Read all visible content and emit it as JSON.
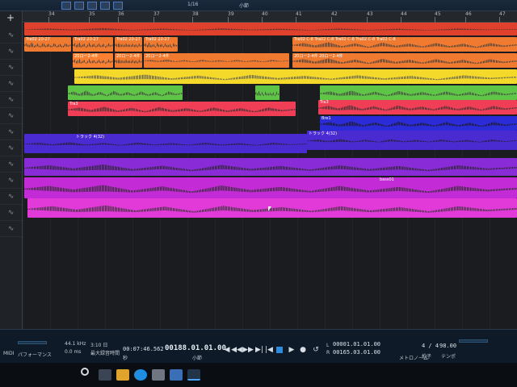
{
  "toolbar": {
    "quantize": "1/16",
    "mode": "小節",
    "icons": [
      "arrow-tool-icon",
      "pencil-icon",
      "eraser-icon",
      "split-icon",
      "mute-icon"
    ]
  },
  "ruler": {
    "bars": [
      "34",
      "35",
      "36",
      "37",
      "38",
      "39",
      "40",
      "41",
      "42",
      "43",
      "44",
      "45",
      "46",
      "47"
    ]
  },
  "track_header": {
    "add_button": "+",
    "track_icons": [
      "waveform-icon",
      "waveform-icon",
      "waveform-icon",
      "waveform-icon",
      "waveform-icon",
      "waveform-icon",
      "waveform-icon",
      "waveform-icon",
      "waveform-icon",
      "waveform-icon",
      "waveform-icon",
      "waveform-icon",
      "waveform-icon"
    ]
  },
  "clips": [
    {
      "row": 0,
      "color": "red",
      "label": ""
    },
    {
      "row": 1,
      "color": "orange",
      "label": "Tra02 20-27"
    },
    {
      "row": 1,
      "color": "orange",
      "label": "Tra02 20-27"
    },
    {
      "row": 1,
      "color": "orange",
      "label": "Tra02 20-27"
    },
    {
      "row": 1,
      "color": "orange",
      "label": "Tra02 20-27"
    },
    {
      "row": 1,
      "color": "orange",
      "label": "Tra02 C-8 Tra02 C-8 Tra02 C-8 Tra02 C-8 Tra02 C-8"
    },
    {
      "row": 2,
      "color": "orange",
      "label": "20ロー2-4件"
    },
    {
      "row": 2,
      "color": "orange",
      "label": "20ロー2-4件"
    },
    {
      "row": 2,
      "color": "orange",
      "label": "20ロー2-4件"
    },
    {
      "row": 2,
      "color": "orange",
      "label": "20ロー2-4件 20ロー2-4件"
    },
    {
      "row": 3,
      "color": "yellow",
      "label": ""
    },
    {
      "row": 4,
      "color": "green",
      "label": ""
    },
    {
      "row": 5,
      "color": "pinkred",
      "label": "Tra3"
    },
    {
      "row": 5,
      "color": "pinkred",
      "label": "Tra3"
    },
    {
      "row": 6,
      "color": "blue",
      "label": "Bre1"
    },
    {
      "row": 7,
      "color": "indigo",
      "label": "トラック 4(32)"
    },
    {
      "row": 7,
      "color": "indigo",
      "label": "トラック 4(32)"
    },
    {
      "row": 8,
      "color": "violet",
      "label": ""
    },
    {
      "row": 9,
      "color": "magenta",
      "label": "bass01"
    },
    {
      "row": 10,
      "color": "pink",
      "label": ""
    }
  ],
  "transport": {
    "midi": "MIDI",
    "performance": "パフォーマンス",
    "sample_rate": "44.1 kHz",
    "latency": "0.0 ms",
    "record_time": "3:10 日",
    "record_label": "最大録音時間",
    "time": "00:07:46.562",
    "time_unit": "秒",
    "position": "00188.01.01.00",
    "position_unit": "小節",
    "loop_start": "00001.01.01.00",
    "loop_end": "00165.03.01.00",
    "loop_labels": [
      "L",
      "R"
    ],
    "signature": "4 / 4",
    "signature_label": "拍子",
    "metronome_label": "メトロノーム",
    "tempo": "98.00",
    "tempo_label": "テンポ"
  },
  "taskbar": {
    "icons": [
      "windows-icon",
      "search-icon",
      "task-view-icon",
      "file-explorer-icon",
      "edge-icon",
      "store-icon",
      "photos-icon",
      "studio-one-icon"
    ]
  }
}
